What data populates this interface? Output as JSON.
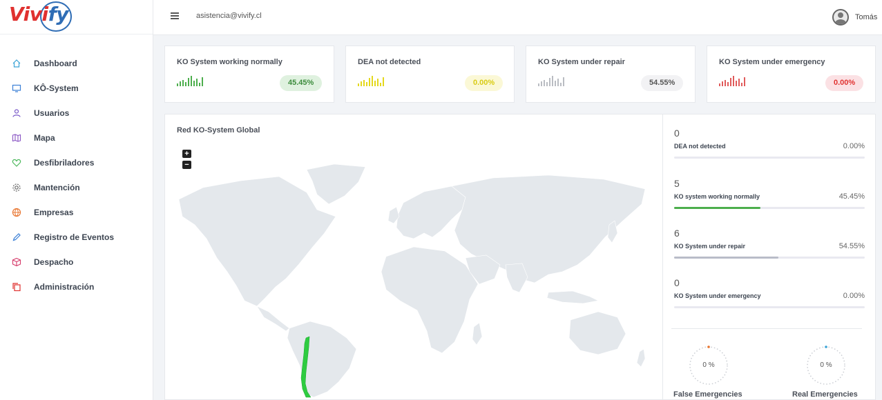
{
  "brand": {
    "logo_prefix": "Vivi",
    "logo_suffix": "fy"
  },
  "header": {
    "email": "asistencia@vivify.cl",
    "user_name": "Tomás",
    "menu_icon": "hamburger-icon",
    "avatar_icon": "user-avatar-icon"
  },
  "sidebar": {
    "items": [
      {
        "label": "Dashboard",
        "icon": "home-icon",
        "color": "#3aa3d6"
      },
      {
        "label": "KÔ-System",
        "icon": "monitor-icon",
        "color": "#3a7fd6"
      },
      {
        "label": "Usuarios",
        "icon": "user-icon",
        "color": "#7b5bc9"
      },
      {
        "label": "Mapa",
        "icon": "map-icon",
        "color": "#8a56c4"
      },
      {
        "label": "Desfibriladores",
        "icon": "heart-icon",
        "color": "#4cb85c"
      },
      {
        "label": "Mantención",
        "icon": "gear-icon",
        "color": "#666666"
      },
      {
        "label": "Empresas",
        "icon": "globe-icon",
        "color": "#e8742e"
      },
      {
        "label": "Registro de Eventos",
        "icon": "pencil-icon",
        "color": "#3a7fd6"
      },
      {
        "label": "Despacho",
        "icon": "box-icon",
        "color": "#d63a6a"
      },
      {
        "label": "Administración",
        "icon": "copy-icon",
        "color": "#e0312f"
      }
    ]
  },
  "cards": [
    {
      "title": "KO System working normally",
      "value": "45.45%",
      "color": "#4cae4c",
      "pill_bg": "#dff1df",
      "pill_fg": "#3c8c3c"
    },
    {
      "title": "DEA not detected",
      "value": "0.00%",
      "color": "#e4d81c",
      "pill_bg": "#fbf8d6",
      "pill_fg": "#d9cb12"
    },
    {
      "title": "KO System under repair",
      "value": "54.55%",
      "color": "#b9bcc2",
      "pill_bg": "#f2f2f4",
      "pill_fg": "#555555"
    },
    {
      "title": "KO System under emergency",
      "value": "0.00%",
      "color": "#e05a5a",
      "pill_bg": "#fbe1e4",
      "pill_fg": "#e0312f"
    }
  ],
  "map": {
    "title": "Red KO-System Global",
    "zoom_in": "+",
    "zoom_out": "−",
    "highlight_color": "#2ecc40",
    "land_color": "#e4e8ec"
  },
  "stats": [
    {
      "count": "0",
      "label": "DEA not detected",
      "pct": "0.00%",
      "fill": 0,
      "color": "#cccccc"
    },
    {
      "count": "5",
      "label": "KO system working normally",
      "pct": "45.45%",
      "fill": 0.4545,
      "color": "#4cae4c"
    },
    {
      "count": "6",
      "label": "KO System under repair",
      "pct": "54.55%",
      "fill": 0.5455,
      "color": "#b9bcc8"
    },
    {
      "count": "0",
      "label": "KO System under emergency",
      "pct": "0.00%",
      "fill": 0,
      "color": "#cccccc"
    }
  ],
  "gauges": [
    {
      "caption": "False Emergencies",
      "value": "0 %",
      "marker_color": "#e8742e"
    },
    {
      "caption": "Real Emergencies",
      "value": "0 %",
      "marker_color": "#3aa3d6"
    }
  ]
}
